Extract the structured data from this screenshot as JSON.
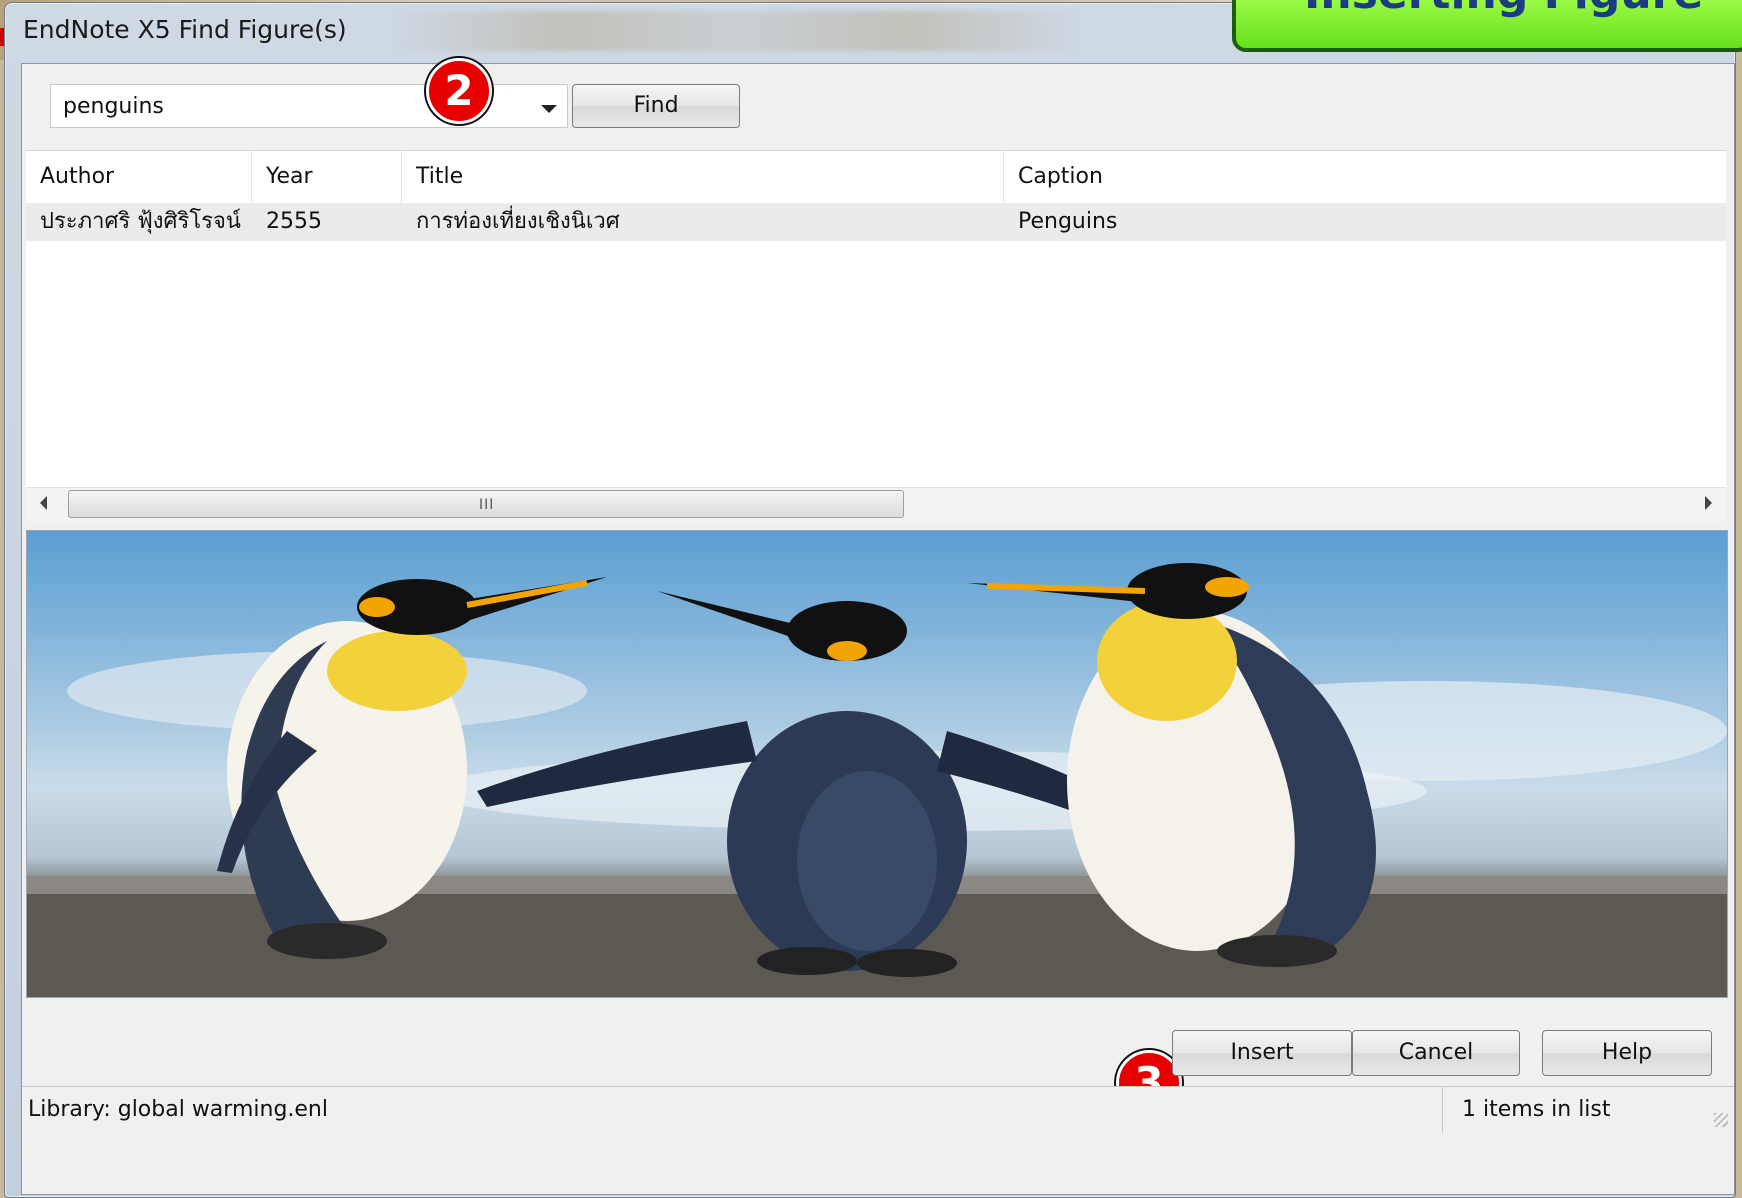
{
  "window": {
    "title": "EndNote X5 Find Figure(s)"
  },
  "banner": {
    "text": "Inserting Figure"
  },
  "search": {
    "value": "penguins",
    "find_label": "Find"
  },
  "markers": {
    "step2": "2",
    "step3": "3"
  },
  "table": {
    "columns": [
      "Author",
      "Year",
      "Title",
      "Caption"
    ],
    "rows": [
      {
        "author": "ประภาศริ ฟุ้งศิริโรจน์",
        "year": "2555",
        "title": "การท่องเที่ยงเชิงนิเวศ",
        "caption": "Penguins"
      }
    ],
    "scroll_grip": "III"
  },
  "preview": {
    "subject": "penguins-image"
  },
  "buttons": {
    "insert": "Insert",
    "cancel": "Cancel",
    "help": "Help"
  },
  "status": {
    "library": "Library: global warming.enl",
    "count": "1 items in list"
  },
  "colors": {
    "banner_bg": "#7cf02a",
    "banner_text": "#1b3b82",
    "marker_red": "#e60000"
  }
}
